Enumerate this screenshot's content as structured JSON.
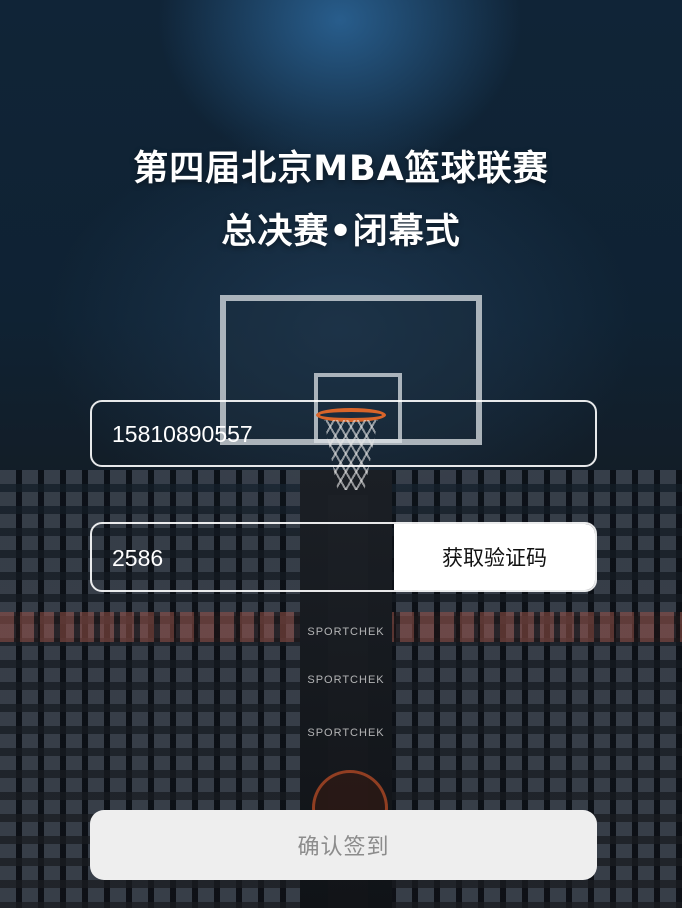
{
  "header": {
    "title_line1": "第四届北京MBA篮球联赛",
    "title_line2": "总决赛•闭幕式"
  },
  "form": {
    "phone_value": "15810890557",
    "code_value": "2586",
    "get_code_label": "获取验证码",
    "confirm_label": "确认签到"
  },
  "background": {
    "sponsor_text": "SPORTCHEK"
  },
  "colors": {
    "button_bg": "#ffffff",
    "confirm_bg": "#eeeeee",
    "confirm_text": "#8c8c8c",
    "rim": "#d9652a"
  }
}
